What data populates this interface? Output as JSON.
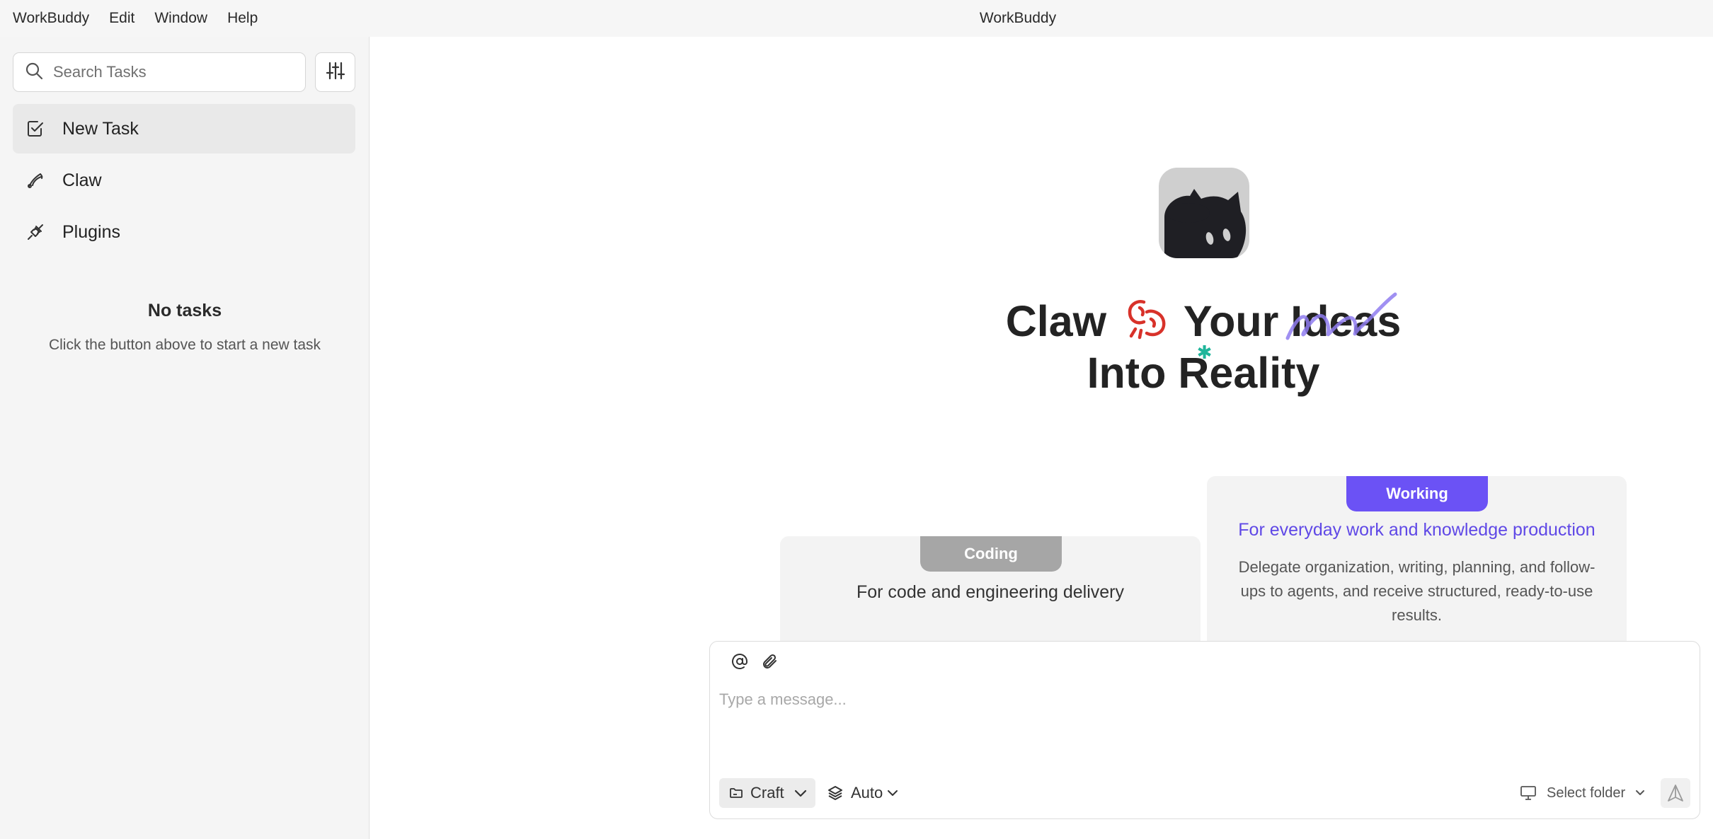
{
  "menubar": {
    "items": [
      "WorkBuddy",
      "Edit",
      "Window",
      "Help"
    ],
    "window_title": "WorkBuddy"
  },
  "sidebar": {
    "search_placeholder": "Search Tasks",
    "nav": [
      {
        "label": "New Task",
        "icon": "new-task-icon",
        "active": true
      },
      {
        "label": "Claw",
        "icon": "claw-icon",
        "active": false
      },
      {
        "label": "Plugins",
        "icon": "plugin-icon",
        "active": false
      }
    ],
    "empty_title": "No tasks",
    "empty_subtitle": "Click the button above to start a new task"
  },
  "hero": {
    "line1_a": "Claw",
    "line1_b": "Your",
    "line1_c": "Ideas",
    "line2_a": "Into R",
    "line2_b": "eality"
  },
  "cards": {
    "coding": {
      "tab": "Coding",
      "title": "For code and engineering delivery"
    },
    "working": {
      "tab": "Working",
      "title": "For everyday work and knowledge production",
      "desc": "Delegate organization, writing, planning, and follow-ups to agents, and receive structured, ready-to-use results."
    }
  },
  "composer": {
    "placeholder": "Type a message...",
    "mode": "Craft",
    "model": "Auto",
    "folder": "Select folder"
  },
  "colors": {
    "accent": "#6b52f5",
    "accent_text": "#5f48e6",
    "lobster": "#d8322a",
    "sparkle": "#1fb59a"
  }
}
